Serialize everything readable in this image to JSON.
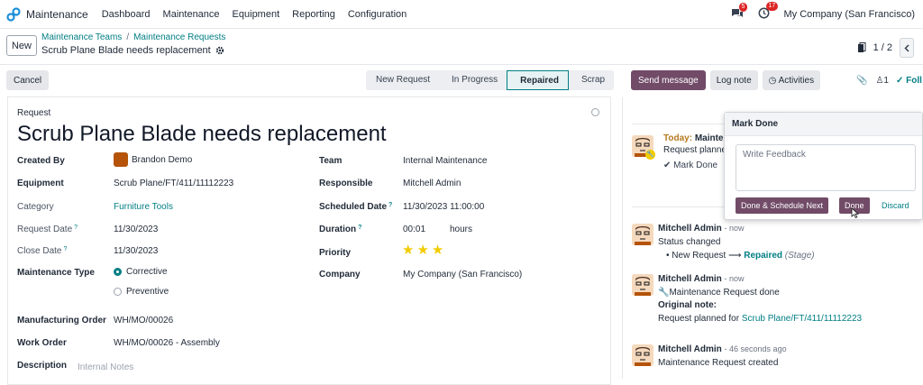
{
  "navbar": {
    "app_name": "Maintenance",
    "menu": [
      "Dashboard",
      "Maintenance",
      "Equipment",
      "Reporting",
      "Configuration"
    ],
    "messages_count": "5",
    "activities_count": "17",
    "company": "My Company (San Francisco)"
  },
  "control": {
    "new_label": "New",
    "breadcrumb": [
      "Maintenance Teams",
      "Maintenance Requests"
    ],
    "record_title": "Scrub Plane Blade needs replacement",
    "pager": "1 / 2"
  },
  "statusbar": {
    "cancel_label": "Cancel",
    "stages": [
      "New Request",
      "In Progress",
      "Repaired",
      "Scrap"
    ],
    "active_stage": "Repaired"
  },
  "form": {
    "label": "Request",
    "title": "Scrub Plane Blade needs replacement",
    "created_by_label": "Created By",
    "created_by": "Brandon Demo",
    "equipment_label": "Equipment",
    "equipment": "Scrub Plane/FT/411/11112223",
    "category_label": "Category",
    "category": "Furniture Tools",
    "request_date_label": "Request Date",
    "request_date": "11/30/2023",
    "close_date_label": "Close Date",
    "close_date": "11/30/2023",
    "maint_type_label": "Maintenance Type",
    "maint_type_corrective": "Corrective",
    "maint_type_preventive": "Preventive",
    "mo_label": "Manufacturing Order",
    "mo": "WH/MO/00026",
    "wo_label": "Work Order",
    "wo": "WH/MO/00026 - Assembly",
    "desc_label": "Description",
    "desc_placeholder": "Internal Notes",
    "team_label": "Team",
    "team": "Internal Maintenance",
    "responsible_label": "Responsible",
    "responsible": "Mitchell Admin",
    "scheduled_label": "Scheduled Date",
    "scheduled": "11/30/2023 11:00:00",
    "duration_label": "Duration",
    "duration": "00:01",
    "duration_unit": "hours",
    "priority_label": "Priority",
    "priority_stars": 3,
    "company_label": "Company",
    "company": "My Company (San Francisco)"
  },
  "chatter": {
    "send_label": "Send message",
    "log_label": "Log note",
    "activities_label": "Activities",
    "followers_count": "1",
    "follow_label": "Foll",
    "activity": {
      "today": "Today:",
      "title": "Mainte",
      "desc": "Request planne",
      "mark_done": "Mark Done"
    },
    "messages": [
      {
        "author": "Mitchell Admin",
        "time": "- now",
        "line1": "Status changed",
        "from": "New Request",
        "to": "Repaired",
        "field": "(Stage)"
      },
      {
        "author": "Mitchell Admin",
        "time": "- now",
        "line1": "Maintenance Request done",
        "line2": "Original note:",
        "line3": "Request planned for",
        "link": "Scrub Plane/FT/411/11112223"
      },
      {
        "author": "Mitchell Admin",
        "time": "- 46 seconds ago",
        "line1": "Maintenance Request created"
      }
    ]
  },
  "popover": {
    "title": "Mark Done",
    "placeholder": "Write Feedback",
    "schedule_next": "Done & Schedule Next",
    "done": "Done",
    "discard": "Discard"
  },
  "colors": {
    "brand": "#714b67",
    "accent": "#017e84",
    "badge": "#dc2626",
    "star": "#f3cc00"
  }
}
